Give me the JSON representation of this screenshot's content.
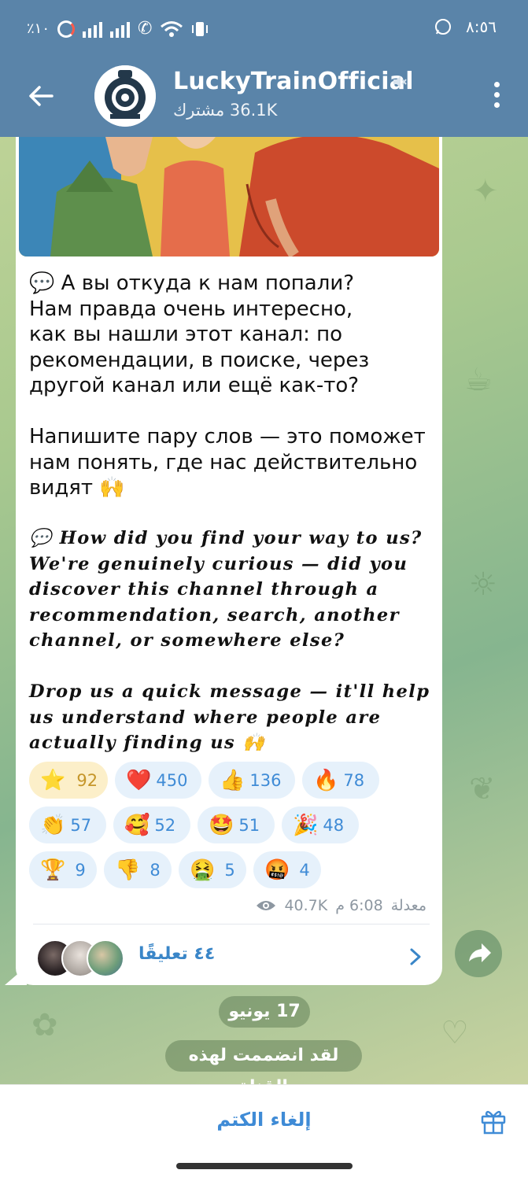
{
  "statusbar": {
    "battery": "٪١٠",
    "time": "٨:٥٦"
  },
  "header": {
    "title": "LuckyTrainOfficial",
    "subtitle": "36.1K مشترك"
  },
  "message": {
    "ru_text": "💬 А вы откуда к нам попали?\nНам правда очень интересно,\nкак вы нашли этот канал: по\nрекомендации, в поиске, через\nдругой канал или ещё как-то?\n\nНапишите пару слов — это поможет\nнам понять, где нас действительно\nвидят 🙌",
    "en_text": "💬 How did you find your way to us?\nWe're genuinely curious — did you\ndiscover this channel through a\nrecommendation, search, another\nchannel, or somewhere else?\n\nDrop us a quick message — it'll help\nus understand where people are\nactually finding us 🙌",
    "reactions": [
      {
        "emoji": "⭐",
        "count": "92"
      },
      {
        "emoji": "❤️",
        "count": "450"
      },
      {
        "emoji": "👍",
        "count": "136"
      },
      {
        "emoji": "🔥",
        "count": "78"
      },
      {
        "emoji": "👏",
        "count": "57"
      },
      {
        "emoji": "🥰",
        "count": "52"
      },
      {
        "emoji": "🤩",
        "count": "51"
      },
      {
        "emoji": "🎉",
        "count": "48"
      },
      {
        "emoji": "🏆",
        "count": "9"
      },
      {
        "emoji": "👎",
        "count": "8"
      },
      {
        "emoji": "🤮",
        "count": "5"
      },
      {
        "emoji": "🤬",
        "count": "4"
      }
    ],
    "views": "40.7K",
    "time": "6:08 م",
    "edited": "معدلة",
    "comments_label": "٤٤ تعليقًا"
  },
  "service": {
    "date": "17 يونيو",
    "joined": "لقد انضممت لهذه القناة"
  },
  "bottom": {
    "unmute_label": "إلغاء الكتم"
  },
  "colors": {
    "header": "#5a84a9",
    "accent": "#3f8bd6"
  }
}
